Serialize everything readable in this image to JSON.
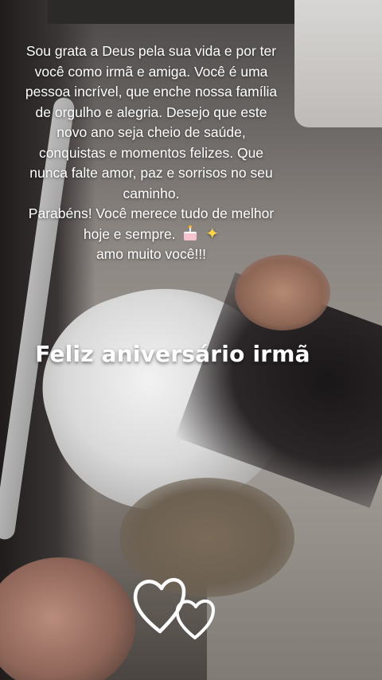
{
  "message": {
    "lines": [
      "Sou grata a Deus pela sua vida e por ter",
      "você como irmã e amiga. Você é uma",
      "pessoa incrível, que enche nossa família",
      "de orgulho e alegria. Desejo que este",
      "novo ano seja cheio de saúde,",
      "conquistas e momentos felizes. Que",
      "nunca falte amor, paz e sorrisos no seu",
      "caminho.",
      "Parabéns! Você merece tudo de melhor",
      "hoje e sempre.",
      "amo muito você!!!"
    ],
    "emoji_after_line_10": [
      "birthday-cake",
      "sparkles"
    ]
  },
  "title": "Feliz aniversário irmã",
  "decoration": {
    "hearts_icon": "double-heart-outline-icon",
    "heart_color": "#ffffff"
  }
}
